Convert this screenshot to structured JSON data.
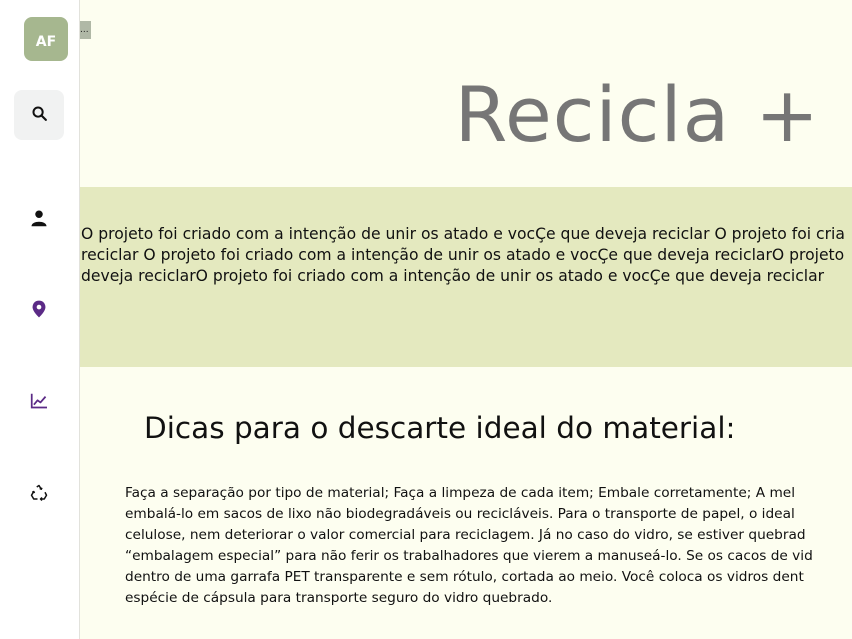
{
  "sidebar": {
    "avatar_initials": "AF",
    "items": [
      {
        "icon": "search-icon"
      },
      {
        "icon": "user-icon"
      },
      {
        "icon": "map-pin-icon",
        "color": "#5b2a86"
      },
      {
        "icon": "chart-line-icon",
        "color": "#5b2a86"
      },
      {
        "icon": "recycle-icon"
      }
    ]
  },
  "main": {
    "broken_image_alt": "...",
    "title": "Recicla +",
    "intro_lines": [
      "O projeto foi criado com a intenção de unir os atado e vocÇe que deveja reciclar O projeto foi cria",
      "reciclar O projeto foi criado com a intenção de unir os atado e vocÇe que deveja reciclarO projeto",
      "deveja reciclarO projeto foi criado com a intenção de unir os atado e vocÇe que deveja reciclar"
    ],
    "tips_title": "Dicas para o descarte ideal do material:",
    "tips_lines": [
      "Faça a separação por tipo de material; Faça a limpeza de cada item; Embale corretamente; A mel",
      "embalá-lo em sacos de lixo não biodegradáveis ou recicláveis. Para o transporte de papel, o ideal",
      "celulose, nem deteriorar o valor comercial para reciclagem. Já no caso do vidro, se estiver quebrad",
      "“embalagem especial” para não ferir os trabalhadores que vierem a manuseá-lo. Se os cacos de vid",
      "dentro de uma garrafa PET transparente e sem rótulo, cortada ao meio. Você coloca os vidros dent",
      "espécie de cápsula para transporte seguro do vidro quebrado."
    ]
  },
  "colors": {
    "background": "#fdfef0",
    "band": "#e4e9bf",
    "avatar": "#a6b78f",
    "accent": "#5b2a86"
  }
}
